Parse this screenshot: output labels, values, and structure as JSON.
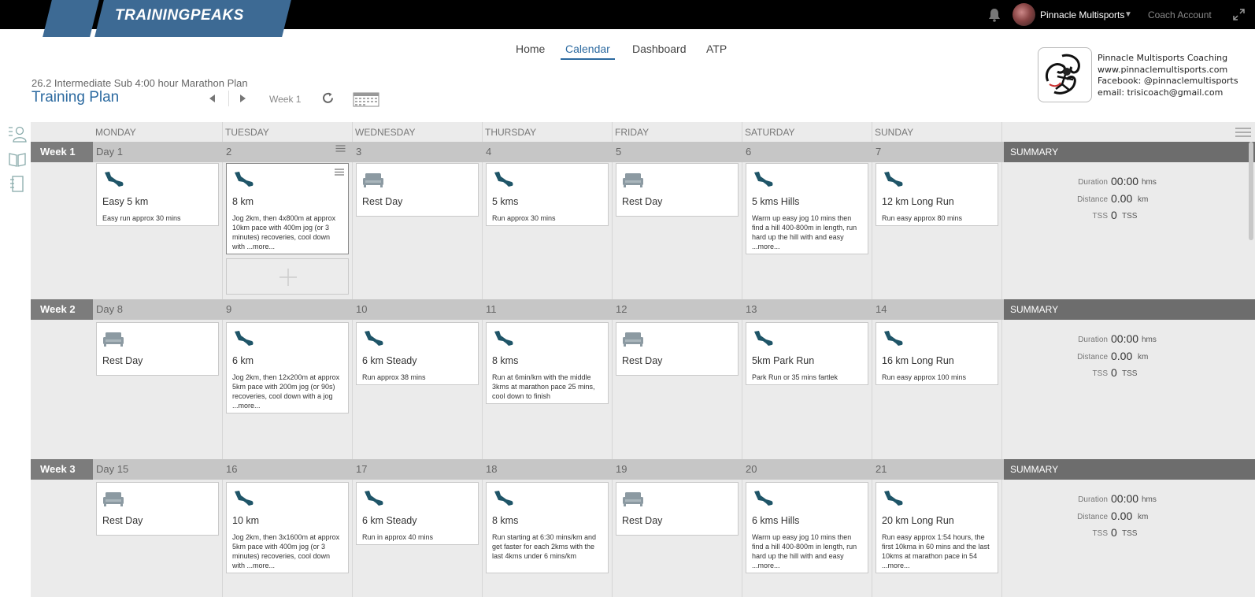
{
  "topbar": {
    "logo_text": "TRAININGPEAKS",
    "account_name": "Pinnacle Multisports",
    "coach_account": "Coach Account"
  },
  "nav": {
    "items": [
      {
        "label": "Home"
      },
      {
        "label": "Calendar"
      },
      {
        "label": "Dashboard"
      },
      {
        "label": "ATP"
      }
    ],
    "active": "Calendar"
  },
  "plan": {
    "name": "26.2 Intermediate Sub 4:00 hour Marathon Plan",
    "title": "Training Plan",
    "week_label": "Week 1"
  },
  "coach": {
    "lines": [
      "Pinnacle Multisports Coaching",
      "www.pinnaclemultisports.com",
      "Facebook: @pinnaclemultisports",
      "email: trisicoach@gmail.com"
    ]
  },
  "calendar": {
    "days": [
      "MONDAY",
      "TUESDAY",
      "WEDNESDAY",
      "THURSDAY",
      "FRIDAY",
      "SATURDAY",
      "SUNDAY"
    ],
    "summary_label": "SUMMARY",
    "summary": {
      "duration_label": "Duration",
      "duration_value": "00:00",
      "duration_unit": "hms",
      "distance_label": "Distance",
      "distance_value": "0.00",
      "distance_unit": "km",
      "tss_label": "TSS",
      "tss_value": "0",
      "tss_unit": "TSS"
    },
    "weeks": [
      {
        "label": "Week 1",
        "day_labels": [
          "Day 1",
          "2",
          "3",
          "4",
          "5",
          "6",
          "7"
        ],
        "workouts": [
          {
            "type": "run",
            "title": "Easy 5 km",
            "desc": "Easy run approx 30 mins"
          },
          {
            "type": "run",
            "title": "8 km",
            "desc": "Jog 2km, then 4x800m at approx 10km pace with 400m jog (or 3 minutes) recoveries, cool down with ...more..."
          },
          {
            "type": "rest",
            "title": "Rest Day",
            "desc": ""
          },
          {
            "type": "run",
            "title": "5 kms",
            "desc": "Run approx 30 mins"
          },
          {
            "type": "rest",
            "title": "Rest Day",
            "desc": ""
          },
          {
            "type": "run",
            "title": "5 kms Hills",
            "desc": "Warm up easy jog 10 mins then find a hill 400-800m in length, run hard up the hill with and easy ...more..."
          },
          {
            "type": "run",
            "title": "12 km Long Run",
            "desc": "Run easy approx 80 mins"
          }
        ]
      },
      {
        "label": "Week 2",
        "day_labels": [
          "Day 8",
          "9",
          "10",
          "11",
          "12",
          "13",
          "14"
        ],
        "workouts": [
          {
            "type": "rest",
            "title": "Rest Day",
            "desc": ""
          },
          {
            "type": "run",
            "title": "6 km",
            "desc": "Jog 2km, then 12x200m at approx 5km pace with 200m jog (or 90s) recoveries, cool down with a jog ...more..."
          },
          {
            "type": "run",
            "title": "6 km Steady",
            "desc": "Run approx 38 mins"
          },
          {
            "type": "run",
            "title": "8 kms",
            "desc": "Run at 6min/km with the middle 3kms at marathon pace 25 mins, cool down to finish"
          },
          {
            "type": "rest",
            "title": "Rest Day",
            "desc": ""
          },
          {
            "type": "run",
            "title": "5km Park Run",
            "desc": "Park Run or 35 mins fartlek"
          },
          {
            "type": "run",
            "title": "16 km Long Run",
            "desc": "Run easy approx 100 mins"
          }
        ]
      },
      {
        "label": "Week 3",
        "day_labels": [
          "Day 15",
          "16",
          "17",
          "18",
          "19",
          "20",
          "21"
        ],
        "workouts": [
          {
            "type": "rest",
            "title": "Rest Day",
            "desc": ""
          },
          {
            "type": "run",
            "title": "10 km",
            "desc": "Jog 2km, then 3x1600m at approx 5km pace with 400m jog (or 3 minutes) recoveries, cool down with ...more..."
          },
          {
            "type": "run",
            "title": "6 km Steady",
            "desc": "Run in approx 40 mins"
          },
          {
            "type": "run",
            "title": "8 kms",
            "desc": "Run starting at 6:30 mins/km and get faster for each 2kms with the last 4kms under 6 mins/km"
          },
          {
            "type": "rest",
            "title": "Rest Day",
            "desc": ""
          },
          {
            "type": "run",
            "title": "6 kms Hills",
            "desc": "Warm up easy jog 10 mins then find a hill 400-800m in length, run hard up the hill with and easy ...more..."
          },
          {
            "type": "run",
            "title": "20 km Long Run",
            "desc": "Run easy approx 1:54 hours, the first 10kma in 60 mins and the last 10kms at marathon pace in 54 ...more..."
          }
        ]
      }
    ]
  }
}
